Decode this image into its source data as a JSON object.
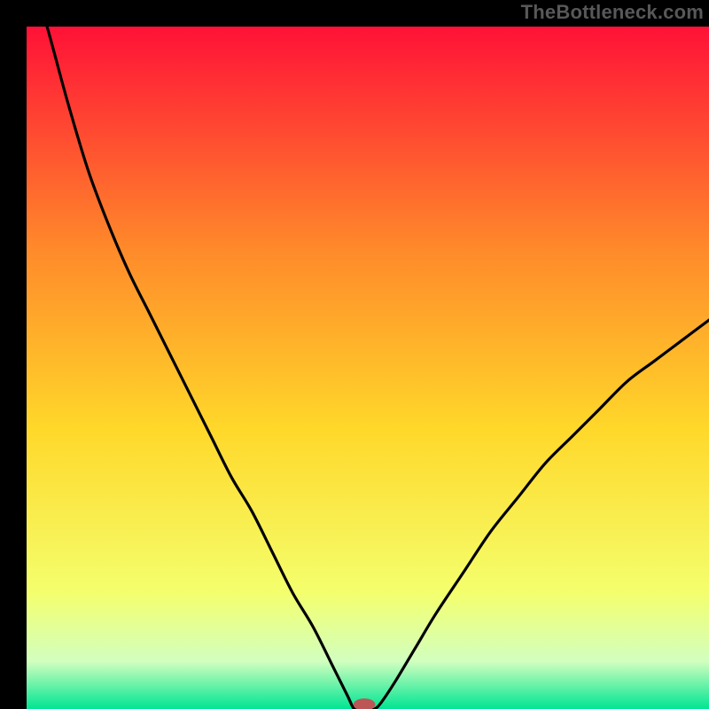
{
  "watermark": "TheBottleneck.com",
  "colors": {
    "black": "#000000",
    "curve": "#000000",
    "marker_fill": "#bc5556",
    "grad_top": "#ff1137",
    "grad_upper_mid": "#ff8b2a",
    "grad_mid": "#ffd82a",
    "grad_lower_mid": "#f4ff6d",
    "grad_near_bottom": "#d2ffbf",
    "grad_bottom": "#00e593"
  },
  "chart_data": {
    "type": "line",
    "title": "",
    "xlabel": "",
    "ylabel": "",
    "xlim": [
      0,
      100
    ],
    "ylim": [
      0,
      100
    ],
    "x": [
      0,
      3,
      6,
      9,
      12,
      15,
      18,
      21,
      24,
      27,
      30,
      33,
      36,
      39,
      42,
      45,
      47,
      48,
      49,
      50,
      51,
      52,
      54,
      57,
      60,
      64,
      68,
      72,
      76,
      80,
      84,
      88,
      92,
      96,
      100
    ],
    "values": [
      110,
      100,
      89,
      79,
      71,
      64,
      58,
      52,
      46,
      40,
      34,
      29,
      23,
      17,
      12,
      6,
      2,
      0,
      0,
      0,
      0,
      1,
      4,
      9,
      14,
      20,
      26,
      31,
      36,
      40,
      44,
      48,
      51,
      54,
      57
    ],
    "marker": {
      "x": 49.5,
      "y": 0,
      "rx": 1.6,
      "ry": 0.9
    },
    "notes": "V-shaped bottleneck curve; y is bottleneck percentage (0=no bottleneck, ~110=strong). Minimum near x≈48-50. Background is a vertical green→yellow→red gradient (green at bottom)."
  }
}
